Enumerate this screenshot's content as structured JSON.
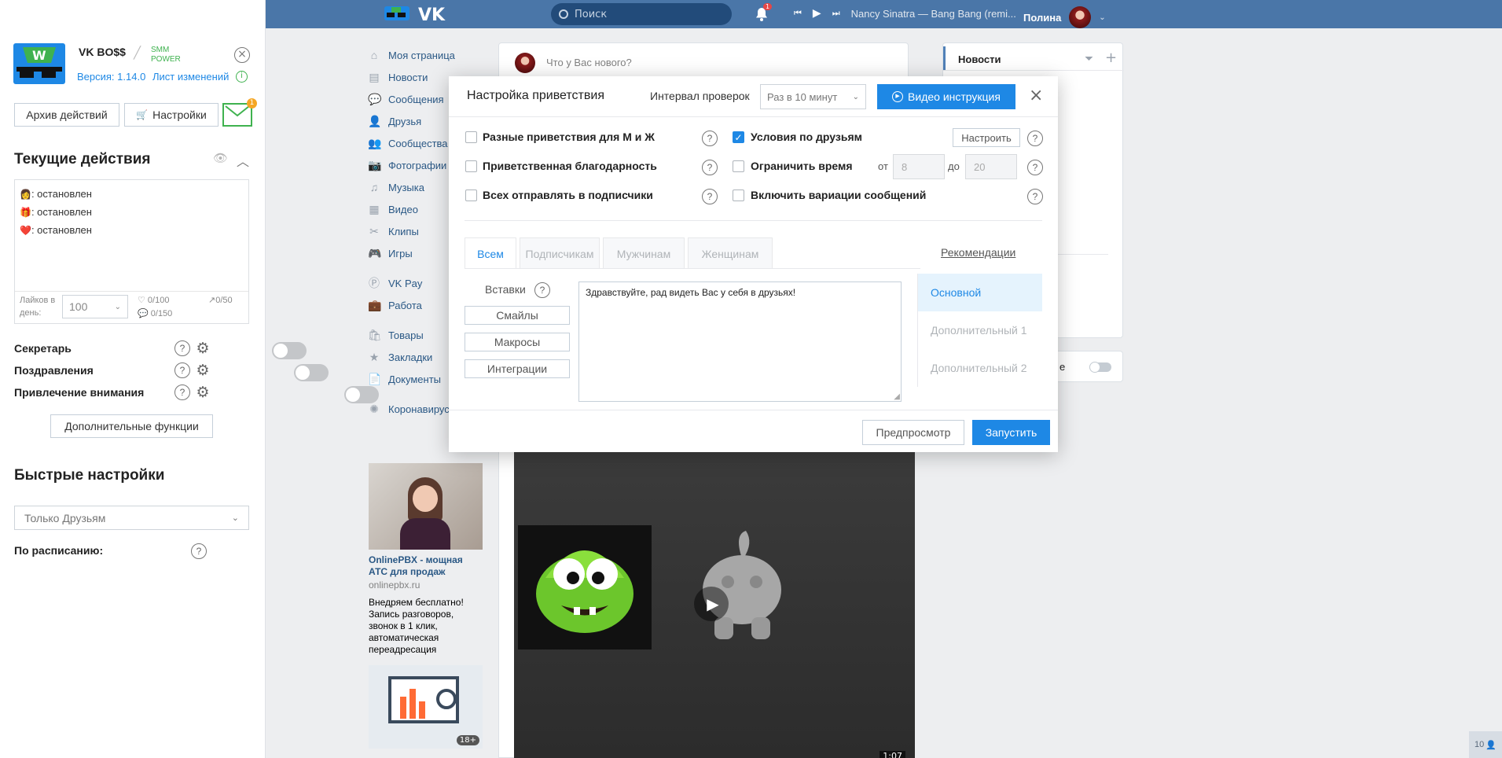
{
  "topbar": {
    "search_placeholder": "Поиск",
    "notification_count": "1",
    "track": "Nancy Sinatra — Bang Bang (remi...",
    "user_name": "Полина"
  },
  "extension": {
    "title": "VK BO$$",
    "subtitle": "SMM POWER",
    "version": "Версия: 1.14.0",
    "changelog": "Лист изменений",
    "archive_button": "Архив действий",
    "settings_button": "Настройки",
    "mail_badge": "1",
    "current_actions_title": "Текущие действия",
    "actions": [
      {
        "emoji": "👩",
        "status": ": остановлен"
      },
      {
        "emoji": "🎁",
        "status": ": остановлен"
      },
      {
        "emoji": "❤️",
        "status": ": остановлен"
      }
    ],
    "likes_label": "Лайков в день:",
    "likes_value": "100",
    "likes_count": "0/100",
    "msgs_count": "0/150",
    "trend_count": "0/50",
    "features": [
      {
        "label": "Секретарь"
      },
      {
        "label": "Поздравления"
      },
      {
        "label": "Привлечение внимания"
      }
    ],
    "more_button": "Дополнительные функции",
    "quick_settings_title": "Быстрые настройки",
    "audience_select": "Только Друзьям",
    "schedule_label": "По расписанию:"
  },
  "nav": {
    "items": [
      {
        "label": "Моя страница",
        "icon": "home-icon"
      },
      {
        "label": "Новости",
        "icon": "news-icon"
      },
      {
        "label": "Сообщения",
        "icon": "messages-icon"
      },
      {
        "label": "Друзья",
        "icon": "friends-icon"
      },
      {
        "label": "Сообщества",
        "icon": "groups-icon"
      },
      {
        "label": "Фотографии",
        "icon": "photo-icon"
      },
      {
        "label": "Музыка",
        "icon": "music-icon"
      },
      {
        "label": "Видео",
        "icon": "video-icon"
      },
      {
        "label": "Клипы",
        "icon": "clips-icon"
      },
      {
        "label": "Игры",
        "icon": "games-icon"
      },
      {
        "label": "VK Pay",
        "icon": "vkpay-icon"
      },
      {
        "label": "Работа",
        "icon": "work-icon"
      },
      {
        "label": "Товары",
        "icon": "goods-icon"
      },
      {
        "label": "Закладки",
        "icon": "bookmarks-icon"
      },
      {
        "label": "Документы",
        "icon": "documents-icon"
      },
      {
        "label": "Коронавирус",
        "icon": "virus-icon"
      }
    ]
  },
  "feed": {
    "post_placeholder": "Что у Вас нового?",
    "video_duration": "1:07"
  },
  "ad": {
    "title": "OnlinePBX - мощная АТС для продаж",
    "domain": "onlinepbx.ru",
    "text": "Внедряем бесплатно! Запись разговоров, звонок в 1 клик, автоматическая переадресация",
    "age_badge": "18+"
  },
  "right": {
    "news_title": "Новости",
    "toggle_tail": "е",
    "counter": "10"
  },
  "modal": {
    "title": "Настройка приветствия",
    "interval_label": "Интервал проверок",
    "interval_value": "Раз в 10 минут",
    "video_button": "Видео инструкция",
    "options": {
      "diff_greetings": "Разные приветствия для М и Ж",
      "thanks": "Приветственная благодарность",
      "all_subscribers": "Всех отправлять в подписчики",
      "friend_conditions": "Условия по друзьям",
      "configure": "Настроить",
      "limit_time": "Ограничить время",
      "from": "от",
      "from_value": "8",
      "to": "до",
      "to_value": "20",
      "variations": "Включить вариации сообщений"
    },
    "tabs": [
      "Всем",
      "Подписчикам",
      "Мужчинам",
      "Женщинам"
    ],
    "inserts_label": "Вставки",
    "insert_buttons": [
      "Смайлы",
      "Макросы",
      "Интеграции"
    ],
    "message": "Здравствуйте, рад видеть Вас у себя в друзьях!",
    "recommendations": "Рекомендации",
    "variants": [
      "Основной",
      "Дополнительный 1",
      "Дополнительный 2"
    ],
    "preview_button": "Предпросмотр",
    "run_button": "Запустить"
  },
  "colors": {
    "header": "#4a76a8",
    "accent": "#1e88e5",
    "link": "#2a5885"
  }
}
